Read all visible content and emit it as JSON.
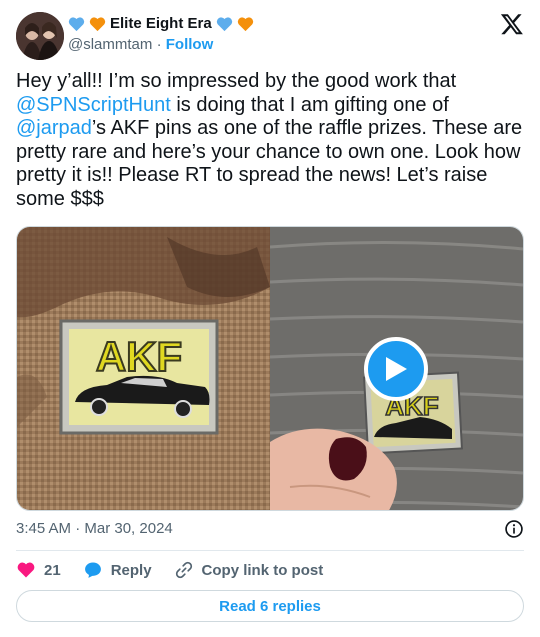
{
  "author": {
    "display_name": "Elite Eight Era",
    "handle": "@slammtam",
    "separator": "·",
    "follow_label": "Follow"
  },
  "tweet": {
    "text_parts": {
      "p1": "Hey y’all!! I’m so impressed by the good work that ",
      "m1": "@SPNScriptHunt",
      "p2": " is doing that I am gifting one of ",
      "m2": "@jarpad",
      "p3": "’s AKF pins as one of the raffle prizes. These are pretty rare and here’s your chance to own one. Look how pretty it is!! Please RT to spread the news! Let’s raise some $$$"
    },
    "pin_text": "AKF",
    "timestamp": "3:45 AM · Mar 30, 2024"
  },
  "actions": {
    "like_count": "21",
    "reply_label": "Reply",
    "copy_label": "Copy link to post"
  },
  "read_replies_label": "Read 6 replies",
  "colors": {
    "accent": "#1d9bf0",
    "heart_pink": "#f91880",
    "muted": "#536471"
  }
}
